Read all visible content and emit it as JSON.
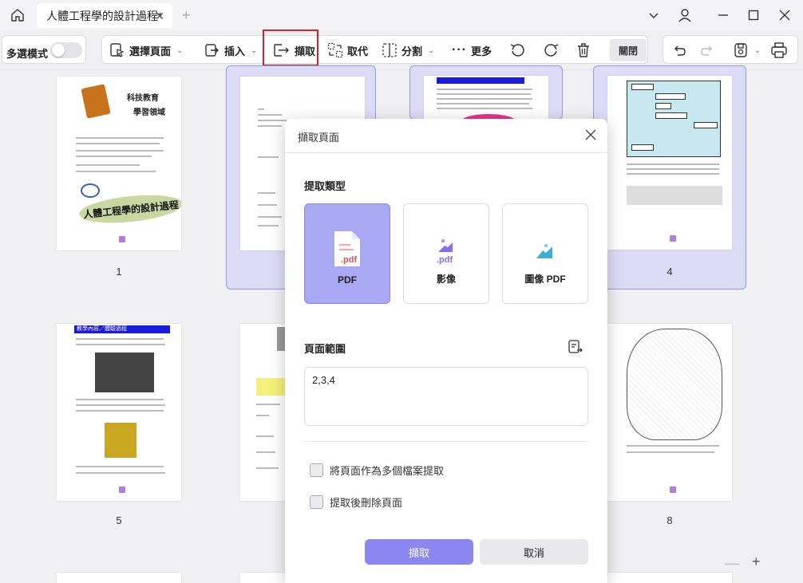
{
  "titlebar": {
    "tab_title": "人體工程學的設計過程*",
    "tab_close": "✕",
    "new_tab": "+"
  },
  "toolbar": {
    "multi_select_label": "多選模式",
    "multi_select_on": false,
    "select_pages": "選擇頁面",
    "insert": "插入",
    "extract": "擷取",
    "replace": "取代",
    "split": "分割",
    "more": "更多",
    "close": "關閉"
  },
  "pages": {
    "p1_num": "1",
    "p4_num": "4",
    "p5_num": "5",
    "p8_num": "8",
    "p1_heading_1": "科技教育",
    "p1_heading_2": "學習領域",
    "p1_banner": "人體工程學的設計過程",
    "p5_banner": "教學內容／體驗過程"
  },
  "modal": {
    "title": "擷取頁面",
    "type_section": "提取類型",
    "types": [
      {
        "label": "PDF",
        "icon": "pdf-file-icon",
        "selected": true
      },
      {
        "label": "影像",
        "icon": "image-pdf-icon",
        "selected": false
      },
      {
        "label": "圖像 PDF",
        "icon": "image-icon",
        "selected": false
      }
    ],
    "pdf_tag": ".pdf",
    "range_section": "頁面範圍",
    "range_value": "2,3,4",
    "option_multi_files": "將頁面作為多個檔案提取",
    "option_delete_after": "提取後刪除頁面",
    "extract_button": "擷取",
    "cancel_button": "取消"
  },
  "colors": {
    "accent": "#8b87f0",
    "selected_card": "#a9a8f4",
    "highlight_border": "#d6202a",
    "selected_page_bg": "#dcdcf6"
  }
}
